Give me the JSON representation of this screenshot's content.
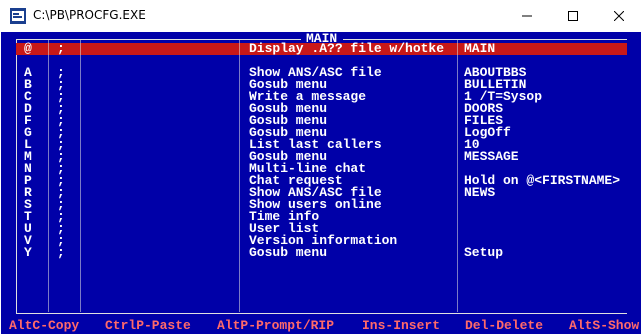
{
  "window": {
    "title": "C:\\PB\\PROCFG.EXE",
    "controls": [
      "minimize",
      "maximize",
      "close"
    ]
  },
  "menu": {
    "title": "MAIN",
    "rows": [
      {
        "key": "@",
        "sep": ";",
        "action": "Display .A?? file w/hotke",
        "arg": "MAIN",
        "selected": true
      },
      {
        "key": "",
        "sep": "",
        "action": "",
        "arg": ""
      },
      {
        "key": "A",
        "sep": ";",
        "action": "Show ANS/ASC file",
        "arg": "ABOUTBBS"
      },
      {
        "key": "B",
        "sep": ";",
        "action": "Gosub menu",
        "arg": "BULLETIN"
      },
      {
        "key": "C",
        "sep": ";",
        "action": "Write a message",
        "arg": "1 /T=Sysop"
      },
      {
        "key": "D",
        "sep": ";",
        "action": "Gosub menu",
        "arg": "DOORS"
      },
      {
        "key": "F",
        "sep": ";",
        "action": "Gosub menu",
        "arg": "FILES"
      },
      {
        "key": "G",
        "sep": ";",
        "action": "Gosub menu",
        "arg": "LogOff"
      },
      {
        "key": "L",
        "sep": ";",
        "action": "List last callers",
        "arg": "10"
      },
      {
        "key": "M",
        "sep": ";",
        "action": "Gosub menu",
        "arg": "MESSAGE"
      },
      {
        "key": "N",
        "sep": ";",
        "action": "Multi-line chat",
        "arg": ""
      },
      {
        "key": "P",
        "sep": ";",
        "action": "Chat request",
        "arg": "Hold on @<FIRSTNAME>"
      },
      {
        "key": "R",
        "sep": ";",
        "action": "Show ANS/ASC file",
        "arg": "NEWS"
      },
      {
        "key": "S",
        "sep": ";",
        "action": "Show users online",
        "arg": ""
      },
      {
        "key": "T",
        "sep": ";",
        "action": "Time info",
        "arg": ""
      },
      {
        "key": "U",
        "sep": ";",
        "action": "User list",
        "arg": ""
      },
      {
        "key": "V",
        "sep": ";",
        "action": "Version information",
        "arg": ""
      },
      {
        "key": "Y",
        "sep": ";",
        "action": "Gosub menu",
        "arg": "Setup"
      }
    ]
  },
  "footer": {
    "keys": [
      "AltC-Copy",
      "CtrlP-Paste",
      "AltP-Prompt/RIP",
      "Ins-Insert",
      "Del-Delete",
      "AltS-Show"
    ]
  },
  "colors": {
    "background": "#0000a8",
    "text": "#ffffff",
    "selection": "#c81818",
    "footer_text": "#ff6a6a"
  }
}
